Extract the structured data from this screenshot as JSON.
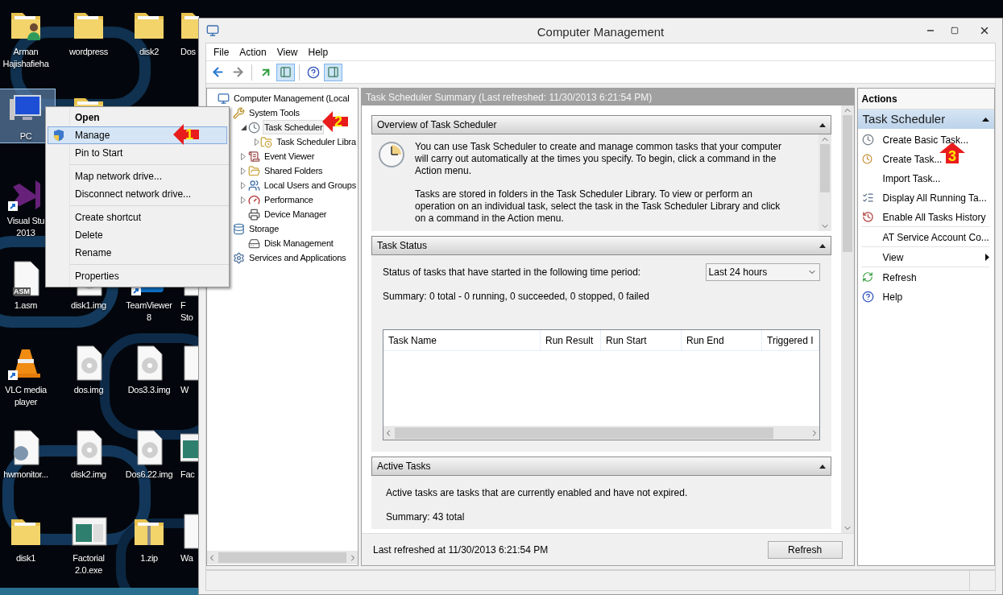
{
  "desktop": {
    "icons": [
      {
        "kind": "user-folder",
        "label": [
          "Arman",
          "Hajishafieha"
        ],
        "selected": false,
        "shortcut": false
      },
      {
        "kind": "folder",
        "label": [
          "wordpress"
        ],
        "selected": false,
        "shortcut": false
      },
      {
        "kind": "folder",
        "label": [
          "disk2"
        ],
        "selected": false,
        "shortcut": false
      },
      {
        "kind": "folder",
        "label": [
          "Dos"
        ],
        "selected": false,
        "shortcut": false
      },
      {
        "kind": "computer",
        "label": [
          "PC"
        ],
        "selected": true,
        "shortcut": false
      },
      {
        "kind": "folder",
        "selected": false
      },
      {
        "kind": "app-logo",
        "label": [
          "Visual Stu",
          "2013"
        ],
        "selected": false,
        "shortcut": true
      },
      {
        "kind": "asm-file",
        "icon_text": "ASM",
        "label": [
          "1.asm"
        ],
        "selected": false,
        "shortcut": false
      },
      {
        "kind": "disc-file",
        "label": [
          "disk1.img"
        ],
        "selected": false,
        "shortcut": false
      },
      {
        "kind": "remote-app",
        "label": [
          "TeamViewer",
          "8"
        ],
        "selected": false,
        "shortcut": true
      },
      {
        "kind": "file",
        "label": [
          "F",
          "Sto"
        ],
        "selected": false,
        "shortcut": false
      },
      {
        "kind": "cone",
        "label": [
          "VLC media",
          "player"
        ],
        "selected": false,
        "shortcut": true
      },
      {
        "kind": "disc-file",
        "label": [
          "dos.img"
        ],
        "selected": false,
        "shortcut": false
      },
      {
        "kind": "disc-file",
        "label": [
          "Dos3.3.img"
        ],
        "selected": false,
        "shortcut": false
      },
      {
        "kind": "file",
        "label": [
          "W"
        ],
        "selected": false,
        "shortcut": false
      },
      {
        "kind": "gear-file",
        "label": [
          "hwmonitor..."
        ],
        "selected": false,
        "shortcut": false
      },
      {
        "kind": "disc-file",
        "label": [
          "disk2.img"
        ],
        "selected": false,
        "shortcut": false
      },
      {
        "kind": "disc-file",
        "label": [
          "Dos6.22.img"
        ],
        "selected": false,
        "shortcut": false
      },
      {
        "kind": "app-window",
        "label": [
          "Fac"
        ],
        "selected": false,
        "shortcut": false
      },
      {
        "kind": "folder",
        "label": [
          "disk1"
        ],
        "selected": false,
        "shortcut": false
      },
      {
        "kind": "app-window",
        "label": [
          "Factorial",
          "2.0.exe"
        ],
        "selected": false,
        "shortcut": false
      },
      {
        "kind": "zip",
        "label": [
          "1.zip"
        ],
        "selected": false,
        "shortcut": false
      },
      {
        "kind": "file",
        "label": [
          "Wa"
        ],
        "selected": false,
        "shortcut": false
      }
    ]
  },
  "context_menu": {
    "items": [
      {
        "kind": "item",
        "label": "Open",
        "bold": true,
        "selected": false
      },
      {
        "kind": "admin-item",
        "label": "Manage",
        "bold": false,
        "selected": true
      },
      {
        "kind": "item",
        "label": "Pin to Start",
        "bold": false,
        "selected": false
      },
      {
        "kind": "separator"
      },
      {
        "kind": "item",
        "label": "Map network drive...",
        "bold": false,
        "selected": false
      },
      {
        "kind": "item",
        "label": "Disconnect network drive...",
        "bold": false,
        "selected": false
      },
      {
        "kind": "separator"
      },
      {
        "kind": "item",
        "label": "Create shortcut",
        "bold": false,
        "selected": false
      },
      {
        "kind": "item",
        "label": "Delete",
        "bold": false,
        "selected": false
      },
      {
        "kind": "item",
        "label": "Rename",
        "bold": false,
        "selected": false
      },
      {
        "kind": "separator"
      },
      {
        "kind": "item",
        "label": "Properties",
        "bold": false,
        "selected": false
      }
    ]
  },
  "annotations": [
    {
      "number": "1"
    },
    {
      "number": "2"
    },
    {
      "number": "3"
    }
  ],
  "window": {
    "title": "Computer Management",
    "menu": [
      "File",
      "Action",
      "View",
      "Help"
    ],
    "toolbar": [
      {
        "kind": "back",
        "disabled": false
      },
      {
        "kind": "forward",
        "disabled": true
      },
      {
        "kind": "separator"
      },
      {
        "kind": "up"
      },
      {
        "kind": "console-tree",
        "selected": true
      },
      {
        "kind": "separator"
      },
      {
        "kind": "help"
      },
      {
        "kind": "action-pane",
        "selected": true
      }
    ],
    "tree": [
      {
        "kind": "computer",
        "label": "Computer Management (Local",
        "selected": false,
        "children": [
          {
            "kind": "tools",
            "label": "System Tools",
            "selected": false,
            "children": [
              {
                "kind": "clock",
                "label": "Task Scheduler",
                "selected": true,
                "expanded": true,
                "children": [
                  {
                    "kind": "folder-clock",
                    "label": "Task Scheduler Libra",
                    "selected": false,
                    "expanded": false
                  }
                ]
              },
              {
                "kind": "event",
                "label": "Event Viewer",
                "selected": false,
                "expanded": false
              },
              {
                "kind": "shared",
                "label": "Shared Folders",
                "selected": false,
                "expanded": false
              },
              {
                "kind": "users",
                "label": "Local Users and Groups",
                "selected": false,
                "expanded": false
              },
              {
                "kind": "performance",
                "label": "Performance",
                "selected": false,
                "expanded": false
              },
              {
                "kind": "device",
                "label": "Device Manager",
                "selected": false
              }
            ]
          },
          {
            "kind": "storage",
            "label": "Storage",
            "selected": false,
            "children": [
              {
                "kind": "disk",
                "label": "Disk Management",
                "selected": false
              }
            ]
          },
          {
            "kind": "services",
            "label": "Services and Applications",
            "selected": false
          }
        ]
      }
    ],
    "summary": {
      "title": "Task Scheduler Summary (Last refreshed: 11/30/2013 6:21:54 PM)",
      "sections": [
        {
          "kind": "overview",
          "title": "Overview of Task Scheduler",
          "expanded": true,
          "paragraphs": [
            "You can use Task Scheduler to create and manage common tasks that your computer will carry out automatically at the times you specify. To begin, click a command in the Action menu.",
            "Tasks are stored in folders in the Task Scheduler Library. To view or perform an operation on an individual task, select the task in the Task Scheduler Library and click on a command in the Action menu."
          ]
        },
        {
          "kind": "status",
          "title": "Task Status",
          "expanded": true,
          "period_label": "Status of tasks that have started in the following time period:",
          "period": "Last 24 hours",
          "summary": "Summary: 0 total - 0 running, 0 succeeded, 0 stopped, 0 failed",
          "columns": [
            "Task Name",
            "Run Result",
            "Run Start",
            "Run End",
            "Triggered I"
          ]
        },
        {
          "kind": "active",
          "title": "Active Tasks",
          "expanded": true,
          "text": "Active tasks are tasks that are currently enabled and have not expired.",
          "summary": "Summary: 43 total"
        }
      ],
      "footer": "Last refreshed at 11/30/2013 6:21:54 PM",
      "refresh_button": "Refresh"
    },
    "actions": {
      "title": "Actions",
      "section": {
        "title": "Task Scheduler",
        "expanded": true,
        "items": [
          {
            "kind": "create-basic",
            "label": "Create Basic Task..."
          },
          {
            "kind": "create",
            "label": "Create Task..."
          },
          {
            "kind": "plain",
            "label": "Import Task..."
          },
          {
            "kind": "display-running",
            "label": "Display All Running Ta..."
          },
          {
            "kind": "history",
            "label": "Enable All Tasks History"
          },
          {
            "kind": "separator"
          },
          {
            "kind": "plain",
            "label": "AT Service Account Co..."
          },
          {
            "kind": "separator"
          },
          {
            "kind": "submenu",
            "label": "View"
          },
          {
            "kind": "separator"
          },
          {
            "kind": "refresh",
            "label": "Refresh"
          },
          {
            "kind": "help",
            "label": "Help"
          }
        ]
      }
    }
  }
}
